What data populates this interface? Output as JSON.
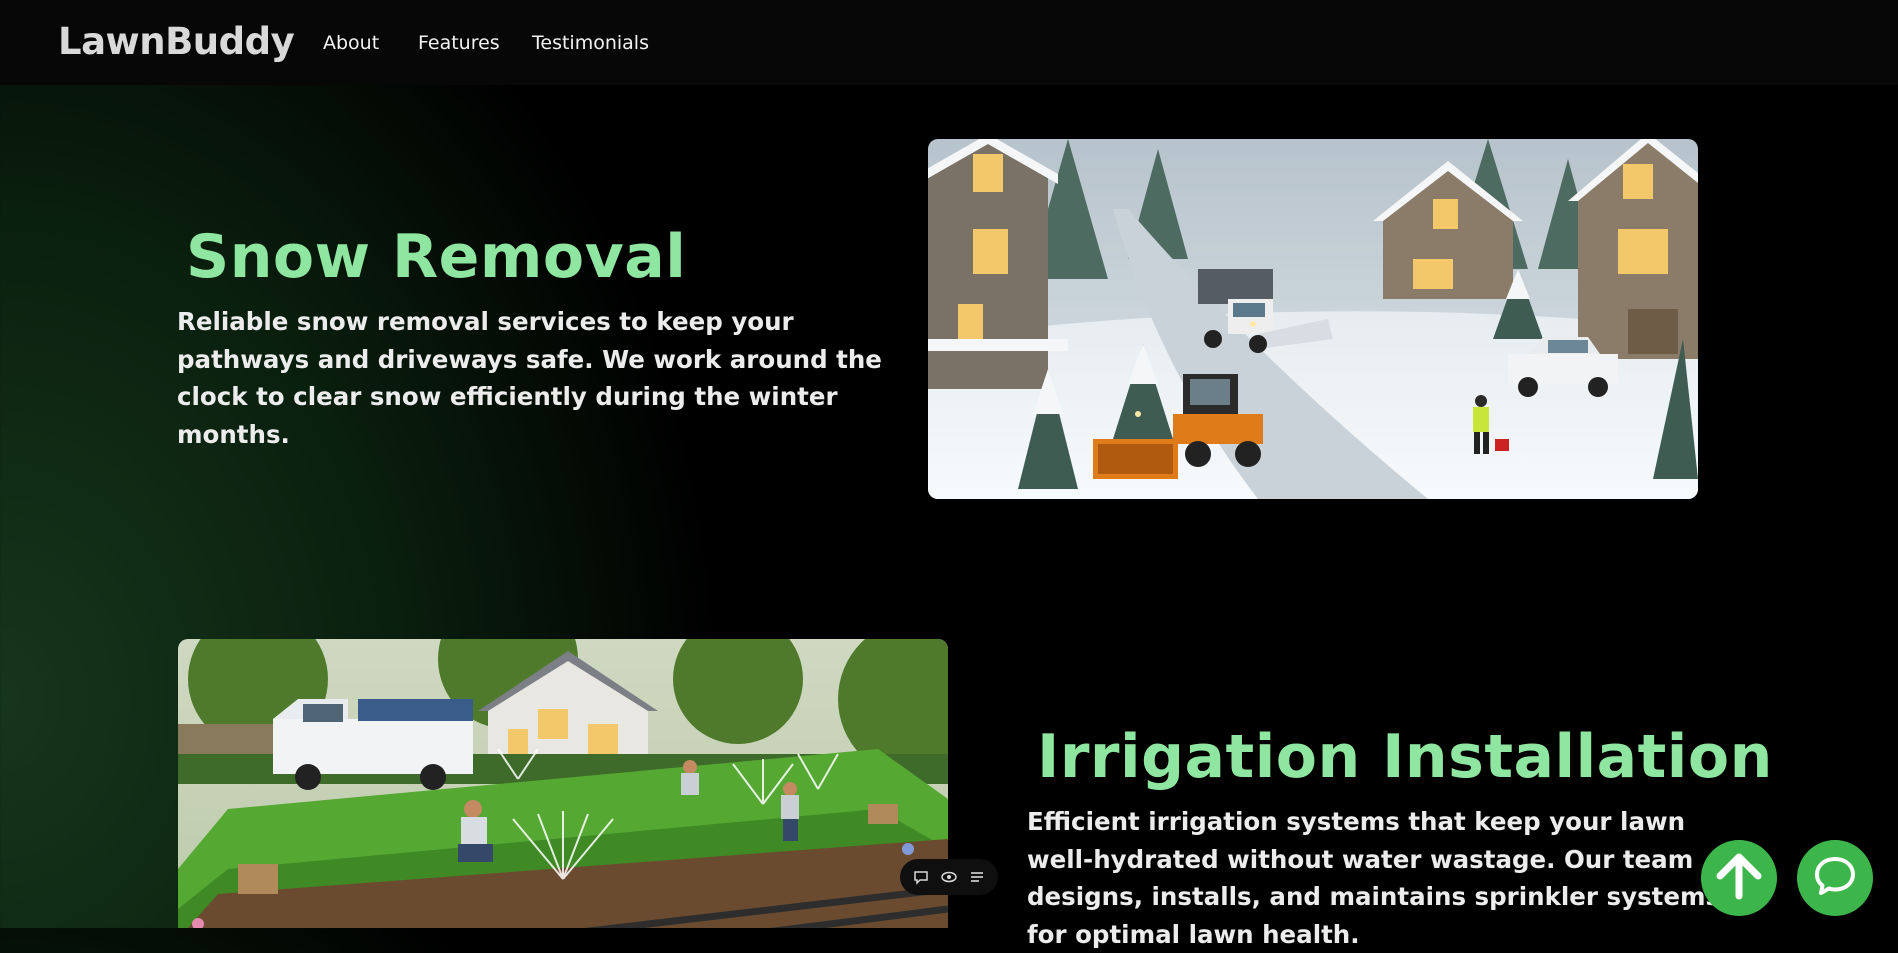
{
  "header": {
    "brand": "LawnBuddy",
    "nav": [
      {
        "label": "About"
      },
      {
        "label": "Features"
      },
      {
        "label": "Testimonials"
      }
    ]
  },
  "sections": [
    {
      "title": "Snow Removal",
      "description": "Reliable snow removal services to keep your pathways and driveways safe. We work around the clock to clear snow efficiently during the winter months.",
      "image_alt": "Snow plow truck and snow blower clearing a snowy neighborhood street"
    },
    {
      "title": "Irrigation Installation",
      "description": "Efficient irrigation systems that keep your lawn well-hydrated without water wastage. Our team designs, installs, and maintains sprinkler systems for optimal lawn health.",
      "image_alt": "Workers installing a sprinkler system in a green lawn"
    }
  ],
  "floating": {
    "scroll_top_icon": "arrow-up-icon",
    "chat_icon": "chat-bubble-icon",
    "toolbar_icons": [
      "comment-icon",
      "eye-icon",
      "list-icon"
    ]
  },
  "colors": {
    "accent_green": "#3cb64a",
    "title_green": "#8ee6a0",
    "navbar_bg": "#070707"
  }
}
